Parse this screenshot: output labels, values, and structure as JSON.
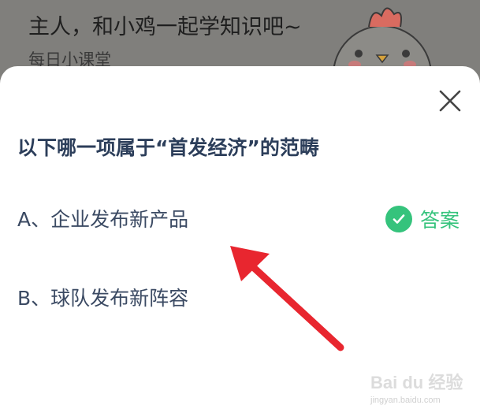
{
  "background": {
    "title": "主人，和小鸡一起学知识吧~",
    "subtitle": "每日小课堂",
    "mascot_icon": "chicken-mascot-icon"
  },
  "quiz": {
    "close_icon": "close-icon",
    "question": "以下哪一项属于“首发经济”的范畴",
    "options": [
      {
        "label": "A、企业发布新产品",
        "is_answer": true
      },
      {
        "label": "B、球队发布新阵容",
        "is_answer": false
      }
    ],
    "answer_label": "答案",
    "answer_icon": "check-circle-icon",
    "accent_color": "#35c37c"
  },
  "annotation": {
    "arrow_color": "#e8262f",
    "arrow_icon": "red-arrow-icon"
  },
  "watermark": {
    "brand": "Bai du 经验",
    "url": "jingyan.baidu.com"
  }
}
